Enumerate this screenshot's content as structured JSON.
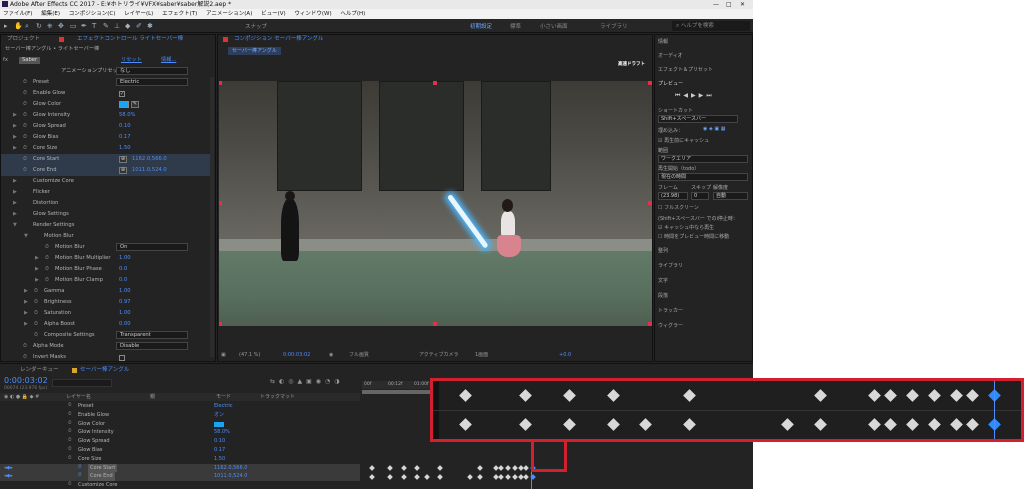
{
  "window": {
    "title": "Adobe After Effects CC 2017 - E:¥ホトリライ¥VFX¥saber¥saber解説2.aep *",
    "controls": [
      "—",
      "□",
      "✕"
    ]
  },
  "menu": [
    "ファイル(F)",
    "編集(E)",
    "コンポジション(C)",
    "レイヤー(L)",
    "エフェクト(T)",
    "アニメーション(A)",
    "ビュー(V)",
    "ウィンドウ(W)",
    "ヘルプ(H)"
  ],
  "toolbar": {
    "snap_label": "スナップ",
    "workspaces": [
      "初期設定",
      "標準",
      "小さい画面",
      "ライブラリ"
    ],
    "active_workspace": "初期設定",
    "search_placeholder": "ヘルプを検索"
  },
  "left_panel": {
    "tabs": [
      "プロジェクト",
      "エフェクトコントロール ライトセーバー棒"
    ],
    "breadcrumb": "セーバー棒アングル • ライトセーバー棒",
    "effect": {
      "name": "Saber",
      "reset": "リセット",
      "about": "情報...",
      "preset_label": "アニメーションプリセット：",
      "preset_value": "なし"
    },
    "props": [
      {
        "label": "Preset",
        "value": "Electric",
        "kind": "dropdown",
        "indent": 0
      },
      {
        "label": "Enable Glow",
        "value": "✓",
        "kind": "check",
        "indent": 0
      },
      {
        "label": "Glow Color",
        "value": "",
        "kind": "color",
        "indent": 0
      },
      {
        "label": "Glow Intensity",
        "value": "58.0%",
        "kind": "num",
        "indent": 0,
        "tw": true
      },
      {
        "label": "Glow Spread",
        "value": "0.10",
        "kind": "num",
        "indent": 0,
        "tw": true
      },
      {
        "label": "Glow Bias",
        "value": "0.17",
        "kind": "num",
        "indent": 0,
        "tw": true
      },
      {
        "label": "Core Size",
        "value": "1.50",
        "kind": "num",
        "indent": 0,
        "tw": true
      },
      {
        "label": "Core Start",
        "value": "1162.0,566.0",
        "kind": "point",
        "indent": 0,
        "sel": true
      },
      {
        "label": "Core End",
        "value": "1011.0,524.0",
        "kind": "point",
        "indent": 0,
        "sel": true
      },
      {
        "label": "Customize Core",
        "value": "",
        "kind": "group",
        "indent": 0
      },
      {
        "label": "Flicker",
        "value": "",
        "kind": "group",
        "indent": 0
      },
      {
        "label": "Distortion",
        "value": "",
        "kind": "group",
        "indent": 0
      },
      {
        "label": "Glow Settings",
        "value": "",
        "kind": "group",
        "indent": 0
      },
      {
        "label": "Render Settings",
        "value": "",
        "kind": "groupopen",
        "indent": 0
      },
      {
        "label": "Motion Blur",
        "value": "",
        "kind": "groupopen",
        "indent": 1
      },
      {
        "label": "Motion Blur",
        "value": "On",
        "kind": "dropdown",
        "indent": 2
      },
      {
        "label": "Motion Blur Multiplier",
        "value": "1.00",
        "kind": "num",
        "indent": 2,
        "tw": true
      },
      {
        "label": "Motion Blur Phase",
        "value": "0.0",
        "kind": "num",
        "indent": 2,
        "tw": true
      },
      {
        "label": "Motion Blur Clamp",
        "value": "0.0",
        "kind": "num",
        "indent": 2,
        "tw": true
      },
      {
        "label": "Gamma",
        "value": "1.00",
        "kind": "num",
        "indent": 1,
        "tw": true
      },
      {
        "label": "Brightness",
        "value": "0.97",
        "kind": "num",
        "indent": 1,
        "tw": true
      },
      {
        "label": "Saturation",
        "value": "1.00",
        "kind": "num",
        "indent": 1,
        "tw": true
      },
      {
        "label": "Alpha Boost",
        "value": "0.00",
        "kind": "num",
        "indent": 1,
        "tw": true
      },
      {
        "label": "Composite Settings",
        "value": "Transparent",
        "kind": "dropdown",
        "indent": 1
      },
      {
        "label": "Alpha Mode",
        "value": "Disable",
        "kind": "dropdown",
        "indent": 0
      },
      {
        "label": "Invert Masks",
        "value": "",
        "kind": "check",
        "indent": 0
      }
    ]
  },
  "comp_panel": {
    "tab": "コンポジション セーバー棒アングル",
    "subtab": "セーバー棒アングル",
    "draft_badge": "高速ドラフト",
    "footer": {
      "zoom": "(47.1 %)",
      "timecode": "0:00:03:02",
      "resolution": "フル画質",
      "camera": "アクティブカメラ",
      "views": "1画面",
      "exposure": "+0.0"
    }
  },
  "right_panel": {
    "sections": [
      "情報",
      "オーディオ",
      "エフェクト＆プリセット",
      "プレビュー"
    ],
    "shortcut_label": "ショートカット",
    "shortcut_value": "Shift+スペースバー",
    "include_label": "埋め込み：",
    "cache_label": "再生前にキャッシュ",
    "range_label": "範囲",
    "range_value": "ワークエリア",
    "play_from_label": "再生開始（todo）",
    "play_from_value": "現在の時間",
    "frame_rate_label": "フレーム",
    "skip_label": "スキップ",
    "resolution_label": "解像度",
    "frame_rate_value": "(23.98)",
    "skip_value": "0",
    "resolution_value": "自動",
    "fullscreen_label": "フルスクリーン",
    "stop_label": "(Shift+スペースバー でのi停止時：",
    "stop_opt1": "キャッシュ中なら再生",
    "stop_opt2": "時間をプレビュー時間に移動",
    "more_sections": [
      "整列",
      "ライブラリ",
      "文字",
      "段落",
      "トラッカー",
      "ウィグラー"
    ]
  },
  "timeline": {
    "tabs": [
      "レンダーキュー",
      "セーバー棒アングル"
    ],
    "timecode": "0:00:03:02",
    "frame_info": "00074 (23.976 fps)",
    "headers": {
      "layer": "レイヤー名",
      "mode": "モード",
      "trkmat": "トラックマット",
      "parent": "親"
    },
    "rows": [
      {
        "label": "Preset",
        "value": "Electric"
      },
      {
        "label": "Enable Glow",
        "value": "オン"
      },
      {
        "label": "Glow Color",
        "value": ""
      },
      {
        "label": "Glow Intensity",
        "value": "58.0%"
      },
      {
        "label": "Glow Spread",
        "value": "0.10"
      },
      {
        "label": "Glow Bias",
        "value": "0.17"
      },
      {
        "label": "Core Size",
        "value": "1.50"
      },
      {
        "label": "Core Start",
        "value": "1162.0,566.0",
        "sel": true
      },
      {
        "label": "Core End",
        "value": "1011.0,524.0",
        "sel": true
      },
      {
        "label": "Customize Core",
        "value": ""
      }
    ],
    "ruler": [
      "00f",
      "00:12f",
      "01:00f"
    ]
  },
  "keyframes_zoomed": {
    "row1": [
      0.03,
      0.14,
      0.22,
      0.3,
      0.44,
      0.68,
      0.78,
      0.81,
      0.85,
      0.89,
      0.93,
      0.96,
      1.0
    ],
    "row2": [
      0.03,
      0.14,
      0.22,
      0.3,
      0.36,
      0.44,
      0.62,
      0.68,
      0.78,
      0.81,
      0.85,
      0.89,
      0.93,
      0.96,
      1.0
    ],
    "current_row1": 1.0,
    "current_row2": 1.0
  }
}
